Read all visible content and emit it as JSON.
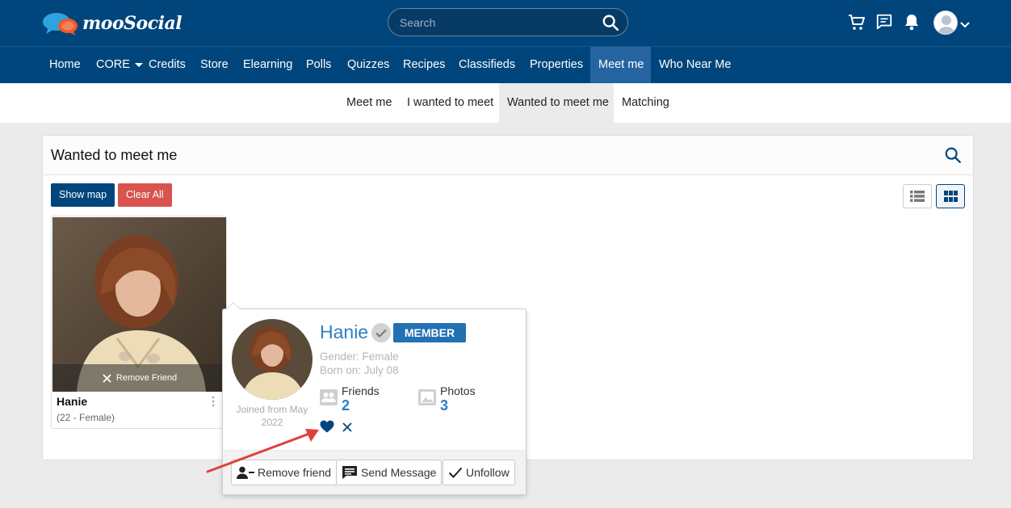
{
  "header": {
    "logo_text": "mooSocial",
    "search_placeholder": "Search"
  },
  "main_nav": [
    {
      "label": "Home"
    },
    {
      "label": "CORE"
    },
    {
      "label": "Credits"
    },
    {
      "label": "Store"
    },
    {
      "label": "Elearning"
    },
    {
      "label": "Polls"
    },
    {
      "label": "Quizzes"
    },
    {
      "label": "Recipes"
    },
    {
      "label": "Classifieds"
    },
    {
      "label": "Properties"
    },
    {
      "label": "Meet me"
    },
    {
      "label": "Who Near Me"
    }
  ],
  "sub_nav": [
    {
      "label": "Meet me"
    },
    {
      "label": "I wanted to meet"
    },
    {
      "label": "Wanted to meet me"
    },
    {
      "label": "Matching"
    }
  ],
  "panel": {
    "title": "Wanted to meet me",
    "show_map": "Show map",
    "clear_all": "Clear All"
  },
  "card": {
    "remove_friend": "Remove Friend",
    "name": "Hanie",
    "sub": "(22 - Female)"
  },
  "popover": {
    "name": "Hanie",
    "badge": "MEMBER",
    "gender": "Gender: Female",
    "born": "Born on: July 08",
    "friends_label": "Friends",
    "friends_count": "2",
    "photos_label": "Photos",
    "photos_count": "3",
    "joined": "Joined from May 2022",
    "btn_remove": "Remove friend",
    "btn_message": "Send Message",
    "btn_unfollow": "Unfollow"
  },
  "colors": {
    "brand": "#00457c",
    "accent": "#2f7fc1",
    "danger": "#d9534f",
    "annotation": "#e0413c"
  }
}
